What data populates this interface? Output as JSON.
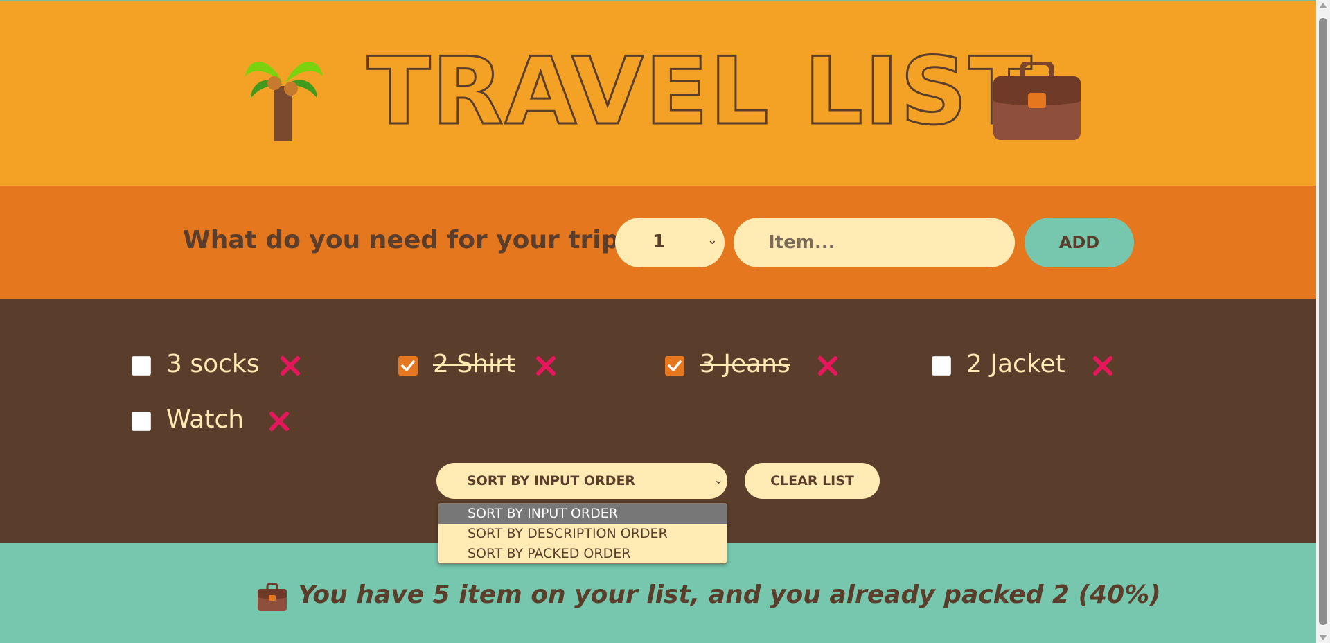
{
  "header": {
    "title": "TRAVEL LIST",
    "left_icon": "palm-tree-icon",
    "right_icon": "briefcase-icon"
  },
  "form": {
    "question": "What do you need for your trip?",
    "quantity_value": "1",
    "item_placeholder": "Item...",
    "add_label": "ADD"
  },
  "items": [
    {
      "label": "3 socks",
      "packed": false
    },
    {
      "label": "2 Shirt",
      "packed": true
    },
    {
      "label": "3 Jeans",
      "packed": true
    },
    {
      "label": "2 Jacket",
      "packed": false
    },
    {
      "label": "Watch",
      "packed": false
    }
  ],
  "actions": {
    "sort_value": "SORT BY INPUT ORDER",
    "sort_options": [
      "SORT BY INPUT ORDER",
      "SORT BY DESCRIPTION ORDER",
      "SORT BY PACKED ORDER"
    ],
    "clear_label": "CLEAR LIST"
  },
  "stats": {
    "text": "You have 5 item on your list, and you already packed 2 (40%)",
    "icon": "briefcase-icon"
  },
  "colors": {
    "header_bg": "#f4a226",
    "form_bg": "#e5771e",
    "list_bg": "#5a3e2b",
    "stats_bg": "#76c7ad",
    "cream": "#ffebb3",
    "delete_x": "#e8175d"
  }
}
